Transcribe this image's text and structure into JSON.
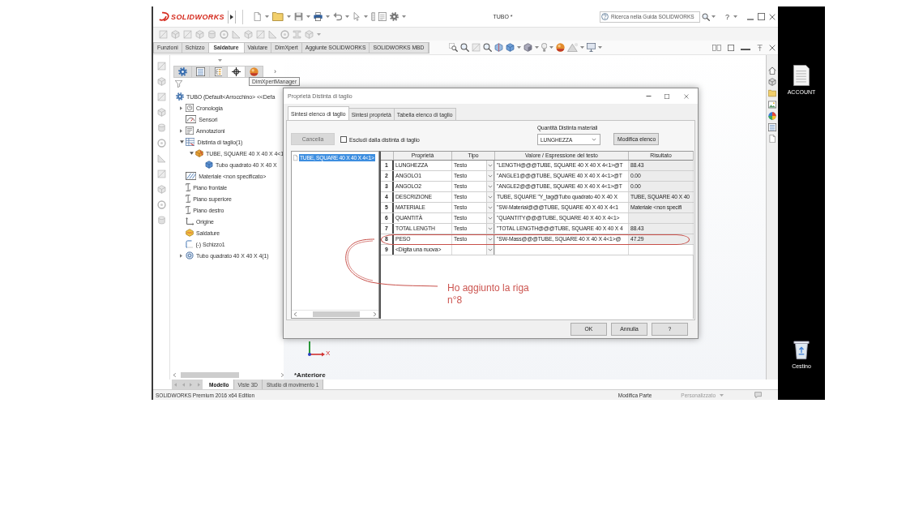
{
  "app_window": {
    "logo": "SOLIDWORKS",
    "title": "TUBO *",
    "search": {
      "placeholder": "Ricerca nella Guida SOLIDWORKS"
    },
    "help": "?"
  },
  "command_tabs": [
    {
      "label": "Funzioni",
      "selected": false
    },
    {
      "label": "Schizzo",
      "selected": false
    },
    {
      "label": "Saldature",
      "selected": true
    },
    {
      "label": "Valutare",
      "selected": false
    },
    {
      "label": "DimXpert",
      "selected": false
    },
    {
      "label": "Aggiunte SOLIDWORKS",
      "selected": false
    },
    {
      "label": "SOLIDWORKS MBD",
      "selected": false
    }
  ],
  "feature_manager": {
    "tabs": [
      {
        "selected": false
      },
      {
        "selected": false
      },
      {
        "selected": false
      },
      {
        "selected": true
      },
      {
        "selected": false
      }
    ],
    "more": "›",
    "tooltip": "DimXpertManager",
    "tree": [
      {
        "label": "TUBO (Default<Arrocchino> <<Defa",
        "kind": "part",
        "children": [
          {
            "label": "Cronologia",
            "kind": "history",
            "expanded": false
          },
          {
            "label": "Sensori",
            "kind": "sensor"
          },
          {
            "label": "Annotazioni",
            "kind": "annotations",
            "expanded": false
          },
          {
            "label": "Distinta di taglio(1)",
            "kind": "cut-list",
            "expanded": true,
            "children": [
              {
                "label": "TUBE, SQUARE 40 X 40 X 4<1",
                "kind": "cut-item",
                "expanded": true,
                "children": [
                  {
                    "label": "Tubo quadrato 40 X 40 X",
                    "kind": "body"
                  }
                ]
              }
            ]
          },
          {
            "label": "Materiale <non specificato>",
            "kind": "material"
          },
          {
            "label": "Piano frontale",
            "kind": "plane"
          },
          {
            "label": "Piano superiore",
            "kind": "plane"
          },
          {
            "label": "Piano destro",
            "kind": "plane"
          },
          {
            "label": "Origine",
            "kind": "origin"
          },
          {
            "label": "Saldature",
            "kind": "weldment"
          },
          {
            "label": "(-) Schizzo1",
            "kind": "sketch"
          },
          {
            "label": "Tubo quadrato 40 X 40 X 4(1)",
            "kind": "member",
            "expanded": false
          }
        ]
      }
    ]
  },
  "dialog": {
    "title": "Proprietà Distinta di taglio",
    "tabs": [
      {
        "label": "Sintesi elenco di taglio",
        "selected": true
      },
      {
        "label": "Sintesi proprietà",
        "selected": false
      },
      {
        "label": "Tabella elenco di taglio",
        "selected": false
      }
    ],
    "clear_button": {
      "label": "Cancella",
      "disabled": true
    },
    "exclude_checkbox": {
      "label": "Escludi dalla distinta di taglio",
      "checked": false
    },
    "quantity": {
      "label": "Quantità Distinta materiali",
      "value": "LUNGHEZZA"
    },
    "edit_list_button": "Modifica elenco",
    "cut_list": [
      {
        "label": "TUBE, SQUARE 40 X 40 X 4<1>",
        "selected": true
      }
    ],
    "table": {
      "columns": [
        "Proprietà",
        "Tipo",
        "Valore / Espressione del testo",
        "Risultato"
      ],
      "rows": [
        {
          "number": "1",
          "property": "LUNGHEZZA",
          "type": "Testo",
          "value": "\"LENGTH@@@TUBE, SQUARE 40 X 40 X 4<1>@T",
          "result": "88.43",
          "circled": false
        },
        {
          "number": "2",
          "property": "ANGOLO1",
          "type": "Testo",
          "value": "\"ANGLE1@@@TUBE, SQUARE 40 X 40 X 4<1>@T",
          "result": "0.00",
          "circled": false
        },
        {
          "number": "3",
          "property": "ANGOLO2",
          "type": "Testo",
          "value": "\"ANGLE2@@@TUBE, SQUARE 40 X 40 X 4<1>@T",
          "result": "0.00",
          "circled": false
        },
        {
          "number": "4",
          "property": "DESCRIZIONE",
          "type": "Testo",
          "value": "TUBE, SQUARE \"Y_tag@Tubo quadrato 40 X 40 X",
          "result": "TUBE, SQUARE 40 X 40",
          "circled": false
        },
        {
          "number": "5",
          "property": "MATERIALE",
          "type": "Testo",
          "value": "\"SW-Material@@@TUBE, SQUARE 40 X 40 X 4<1",
          "result": "Materiale <non specifi",
          "circled": false
        },
        {
          "number": "6",
          "property": "QUANTITÀ",
          "type": "Testo",
          "value": "\"QUANTITY@@@TUBE, SQUARE 40 X 40 X 4<1>",
          "circled": false
        },
        {
          "number": "7",
          "property": "TOTAL LENGTH",
          "type": "Testo",
          "value": "\"TOTAL LENGTH@@@TUBE, SQUARE 40 X 40 X 4",
          "result": "88.43",
          "circled": false
        },
        {
          "number": "8",
          "property": "PESO",
          "type": "Testo",
          "value": "\"SW-Mass@@@TUBE, SQUARE 40 X 40 X 4<1>@",
          "result": "47.29",
          "circled": true
        },
        {
          "number": "9",
          "property": "<Digita una nuova>",
          "circled": false
        }
      ]
    },
    "buttons": [
      "OK",
      "Annulla",
      "?"
    ]
  },
  "annotation": {
    "text": "Ho aggiunto la riga\nn°8"
  },
  "view": {
    "triad_label": "X",
    "orientation": "*Anteriore"
  },
  "bottom_tabs": [
    {
      "label": "Modello",
      "selected": true
    },
    {
      "label": "Viste 3D",
      "selected": false
    },
    {
      "label": "Studio di movimento 1",
      "selected": false
    }
  ],
  "status_bar": {
    "product": "SOLIDWORKS Premium 2016 x64 Edition",
    "mode": "Modifica Parte",
    "units": "Personalizzato"
  },
  "desktop": [
    {
      "label": "ACCOUNT",
      "kind": "file"
    },
    {
      "label": "Cestino",
      "kind": "recycle-bin"
    }
  ]
}
